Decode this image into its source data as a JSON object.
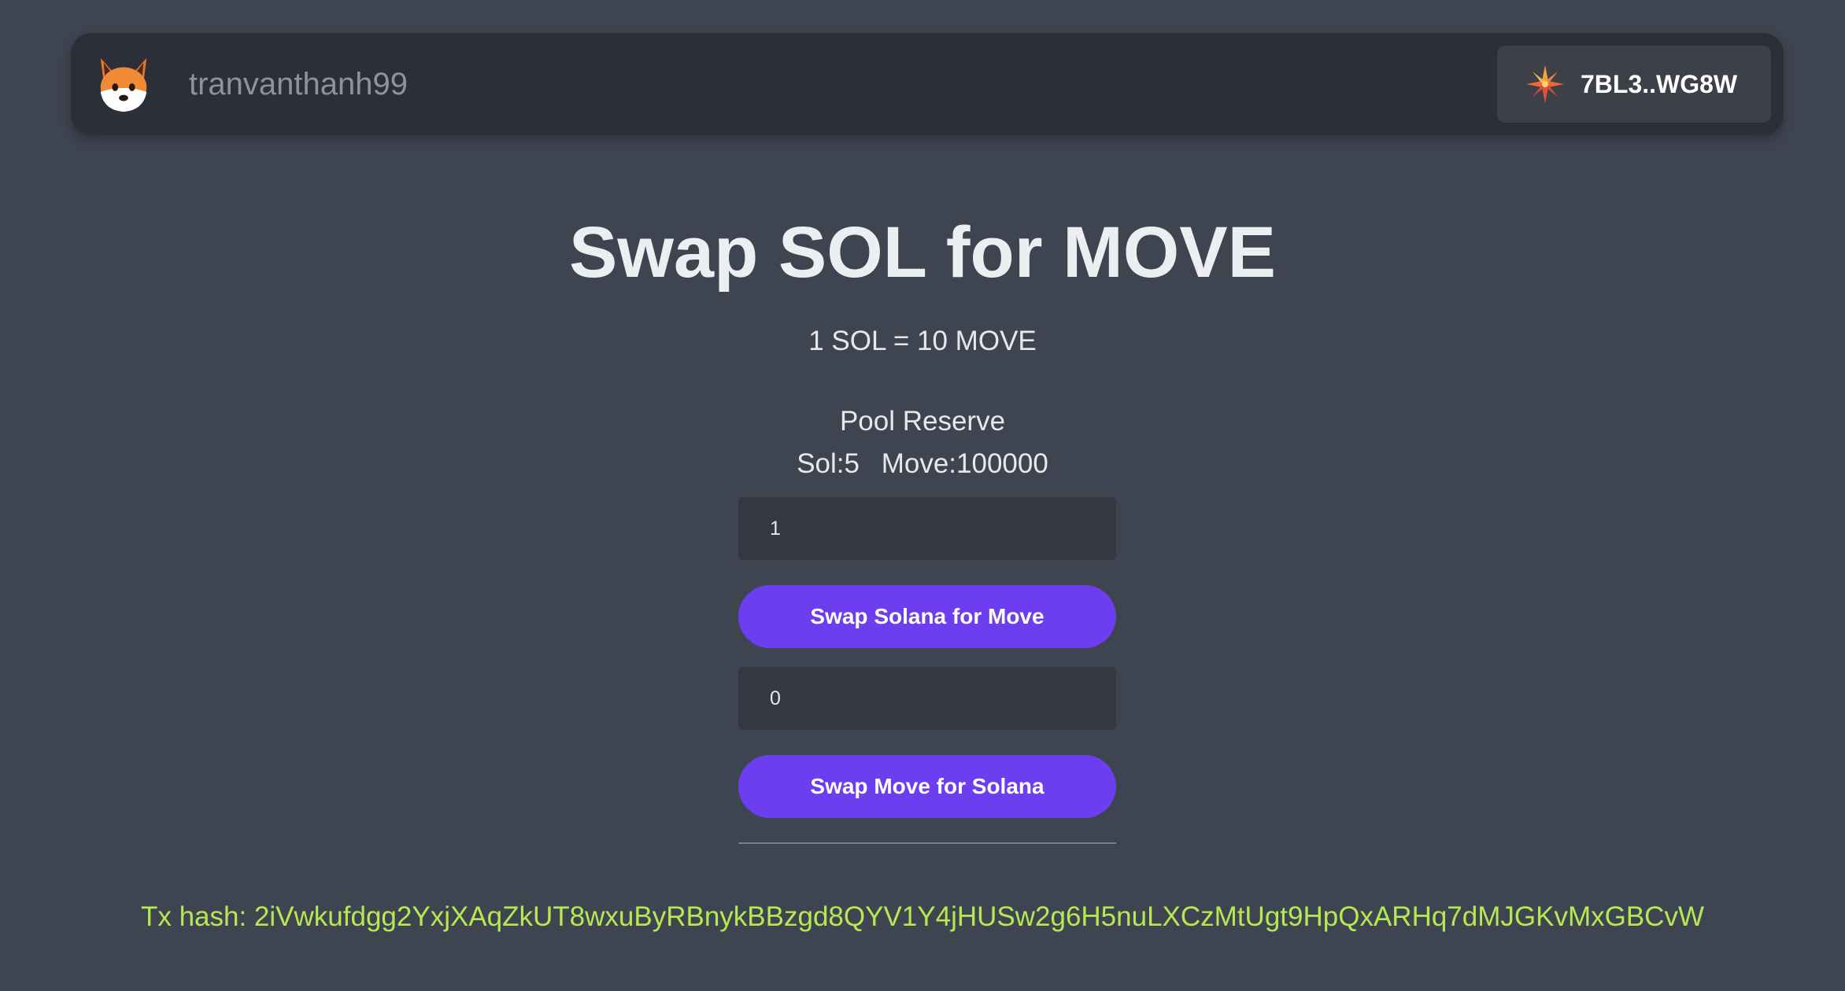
{
  "navbar": {
    "username": "tranvanthanh99",
    "logo_icon": "fox-icon",
    "wallet": {
      "icon": "phantom-sparkle-icon",
      "address": "7BL3..WG8W"
    }
  },
  "main": {
    "title": "Swap SOL for MOVE",
    "rate": "1 SOL = 10 MOVE",
    "pool": {
      "title": "Pool Reserve",
      "sol": "Sol:5",
      "move": "Move:100000"
    },
    "sol_input": {
      "value": "1"
    },
    "swap_sol_label": "Swap Solana for Move",
    "move_input": {
      "value": "0"
    },
    "swap_move_label": "Swap Move for Solana",
    "tx_hash": "Tx hash: 2iVwkufdgg2YxjXAqZkUT8wxuByRBnykBBzgd8QYV1Y4jHUSw2g6H5nuLXCzMtUgt9HpQxARHq7dMJGKvMxGBCvW"
  },
  "colors": {
    "background": "#3f4451",
    "navbar": "#2c2f38",
    "accent": "#6c3ef0",
    "tx_hash": "#b5e853"
  }
}
